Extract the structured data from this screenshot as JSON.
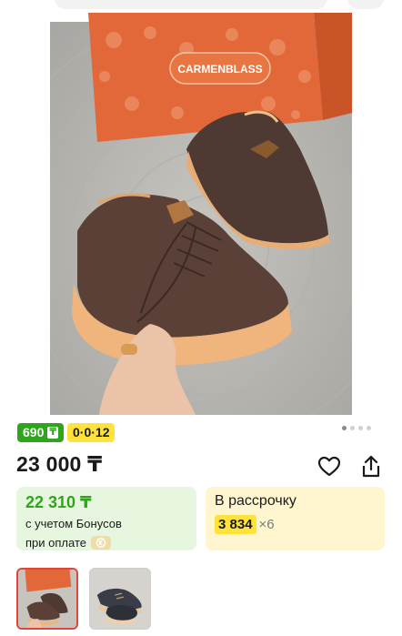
{
  "product": {
    "brand_on_box": "CARMENBLASS",
    "image_alt": "brown leather sneakers on carmenblass box"
  },
  "gallery": {
    "dot_count": 4,
    "active_index": 0
  },
  "badges": {
    "price_badge": "690",
    "currency_mark": "₸",
    "installment_badge": "0·0·12"
  },
  "price": {
    "main": "23 000 ₸"
  },
  "bonus_card": {
    "price": "22 310 ₸",
    "line1": "с учетом Бонусов",
    "line2": "при оплате"
  },
  "installment_card": {
    "title": "В рассрочку",
    "amount": "3 834",
    "months": "×6"
  },
  "icons": {
    "favorite": "heart-icon",
    "share": "share-icon",
    "payment": "kaspi-icon"
  },
  "colors": {
    "green": "#2ea51c",
    "yellow": "#ffe23b",
    "bonus_bg": "#e7f7df",
    "install_bg": "#fff6cf",
    "box_orange": "#e2683a",
    "selected_thumb_border": "#e0453a"
  }
}
